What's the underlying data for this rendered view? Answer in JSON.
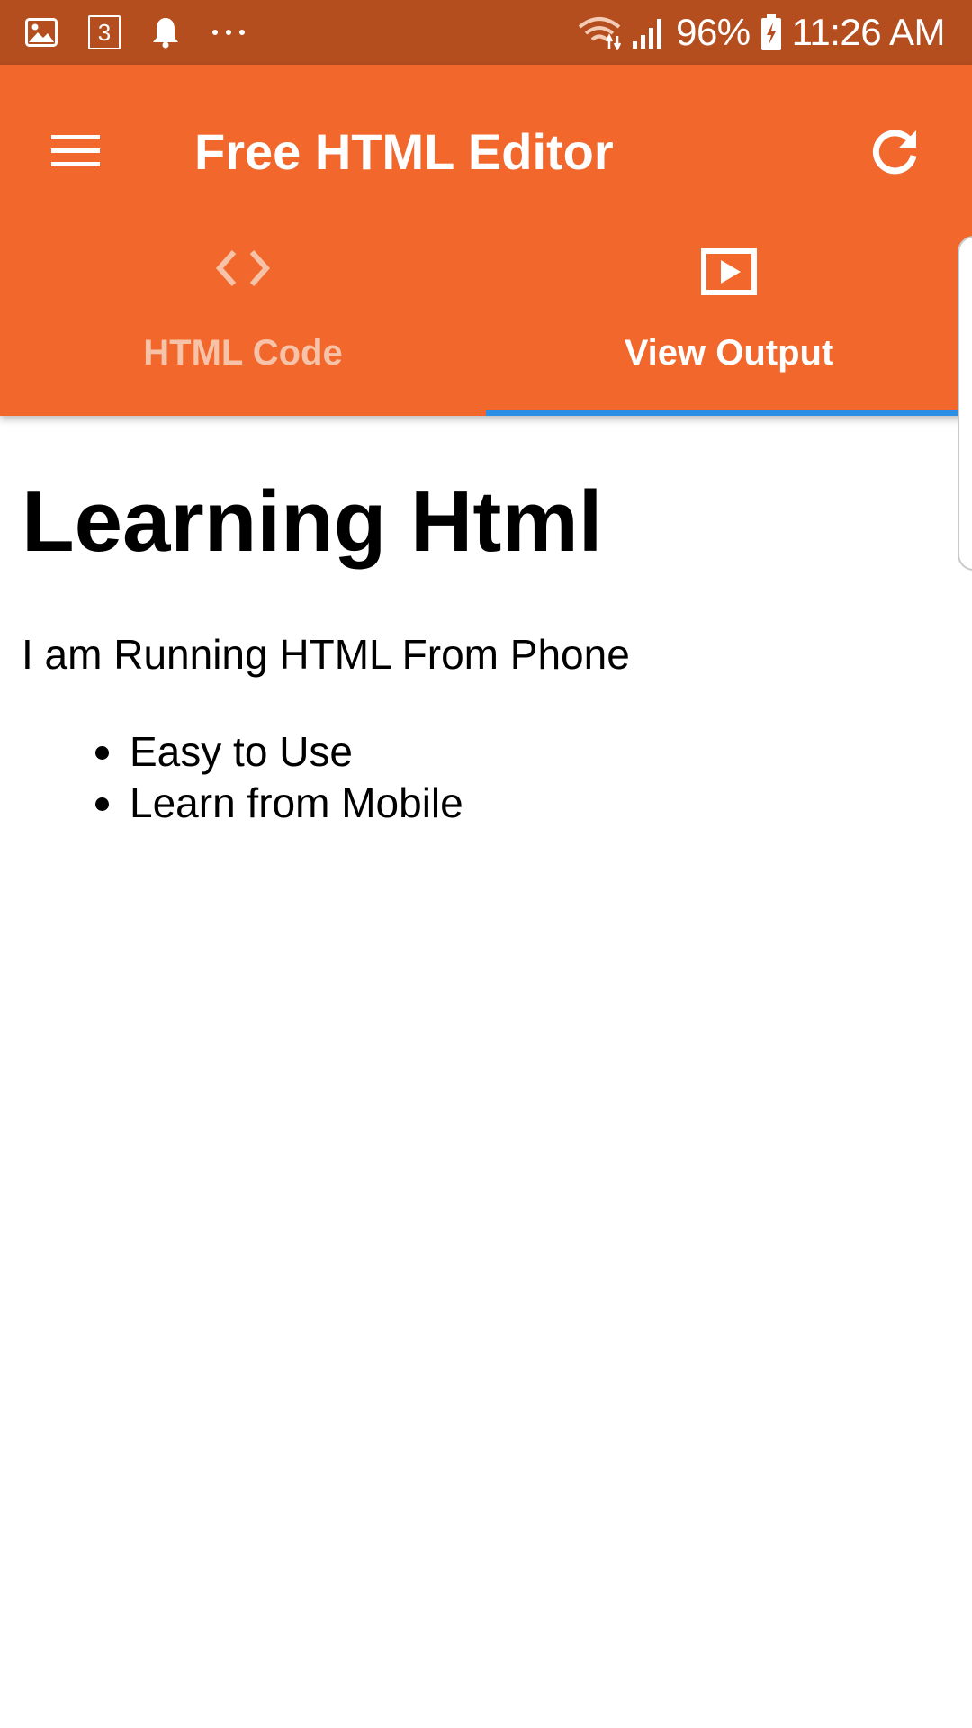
{
  "status_bar": {
    "battery": "96%",
    "time": "11:26 AM",
    "notification_badge": "3",
    "icons": [
      "gallery-icon",
      "calendar-badge-icon",
      "bell-icon",
      "more-dots-icon",
      "wifi-icon",
      "signal-icon",
      "battery-charging-icon"
    ]
  },
  "toolbar": {
    "title": "Free HTML Editor",
    "menu_icon": "hamburger-menu-icon",
    "refresh_icon": "refresh-icon"
  },
  "tabs": [
    {
      "label": "HTML Code",
      "icon": "code-brackets-icon",
      "selected": false
    },
    {
      "label": "View Output",
      "icon": "play-screen-icon",
      "selected": true
    }
  ],
  "output": {
    "heading": "Learning Html",
    "paragraph": "I am Running HTML From Phone",
    "list": [
      "Easy to Use",
      "Learn from Mobile"
    ]
  },
  "colors": {
    "status_bar": "#b44e1f",
    "toolbar": "#f1672c",
    "tab_indicator": "#2d8ee6",
    "inactive_tab_text": "#f7c3a8"
  }
}
